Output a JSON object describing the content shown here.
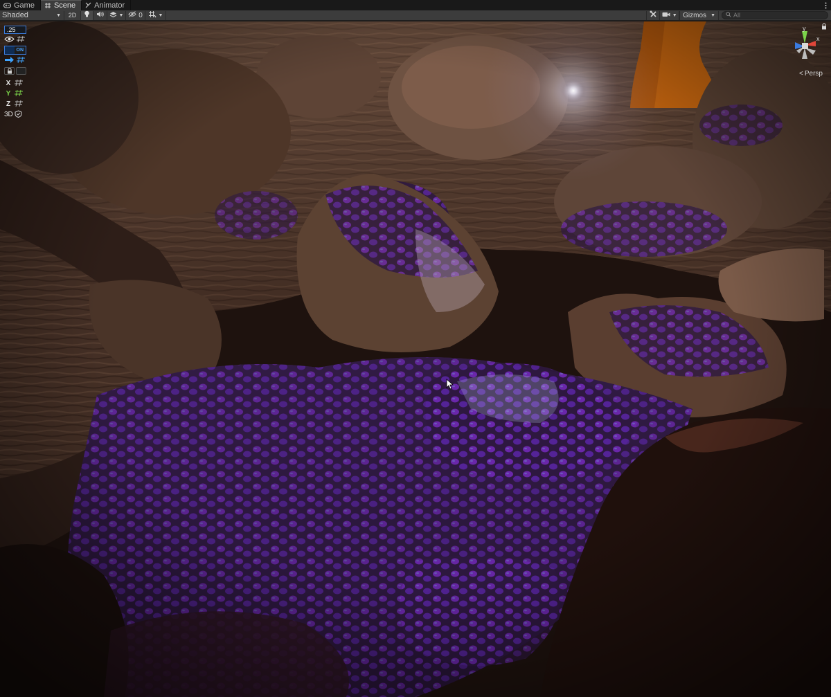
{
  "tabs": [
    {
      "label": "Game",
      "icon": "gamepad-icon",
      "active": false
    },
    {
      "label": "Scene",
      "icon": "grid-icon",
      "active": true
    },
    {
      "label": "Animator",
      "icon": "animator-icon",
      "active": false
    }
  ],
  "toolbar": {
    "shading_mode": "Shaded",
    "mode_2d": "2D",
    "hidden_count": "0",
    "gizmos_label": "Gizmos",
    "search_placeholder": "All"
  },
  "overlay": {
    "grid_size": ".25",
    "snap_state": "ON",
    "axes": [
      "X",
      "Y",
      "Z"
    ],
    "view_3d": "3D"
  },
  "orientation": {
    "projection": "Persp",
    "axis_labels": [
      "y",
      "x"
    ]
  },
  "colors": {
    "accent_blue": "#3b7ad8",
    "axis_x": "#e0463a",
    "axis_y": "#7bd44a",
    "axis_z": "#3a7be0",
    "crystal_purple": "#8a2bd6",
    "rock_brown": "#6b4a36",
    "orange_panel": "#c96a14"
  }
}
